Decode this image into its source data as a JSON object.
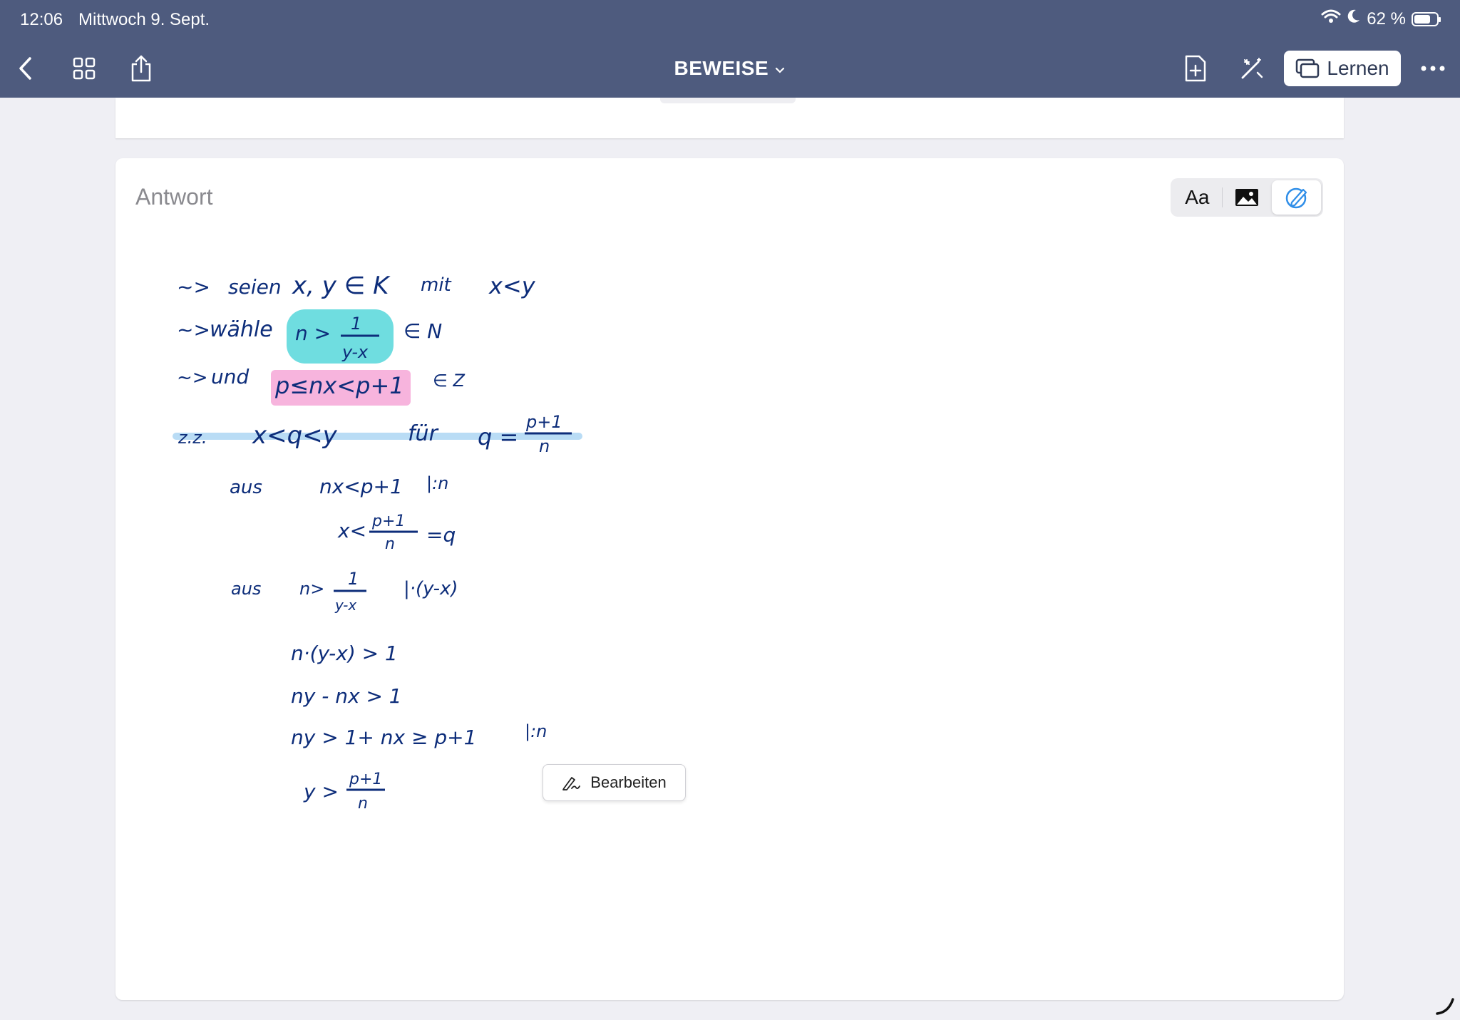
{
  "status_bar": {
    "time": "12:06",
    "date": "Mittwoch 9. Sept.",
    "battery": "62 %"
  },
  "toolbar": {
    "title": "BEWEISE",
    "lernen_label": "Lernen",
    "icons": [
      "chevron-left-icon",
      "grid-icon",
      "share-icon",
      "add-page-icon",
      "wand-icon",
      "cards-icon",
      "more-icon"
    ]
  },
  "card": {
    "label": "Antwort",
    "mode_text_label": "Aa",
    "edit_label": "Bearbeiten"
  },
  "colors": {
    "header": "#4e5b7e",
    "ink": "#0d2d7a",
    "highlight_cyan": "#6fdde0",
    "highlight_pink": "#f7b4dd",
    "highlight_blue": "#b9dcf5",
    "accent": "#2f8ee8"
  },
  "handwriting": {
    "l1_arrow": "~>",
    "l1_seien": "seien",
    "l1_vars": "x, y ∈ K",
    "l1_mit": "mit",
    "l1_cond": "x<y",
    "l2_arrow": "~>",
    "l2_waehle": "wähle",
    "l2_n": "n >",
    "l2_num": "1",
    "l2_den": "y-x",
    "l2_set": "∈ N",
    "l3_arrow": "~>",
    "l3_und": "und",
    "l3_ineq": "p≤nx<p+1",
    "l3_set": "∈ Z",
    "l4_zz": "z.z.",
    "l4_ineq": "x<q<y",
    "l4_fuer": "für",
    "l4_q": "q =",
    "l4_num": "p+1",
    "l4_den": "n",
    "l5_aus": "aus",
    "l5_ineq": "nx<p+1",
    "l5_op": "|:n",
    "l6_x": "x<",
    "l6_num": "p+1",
    "l6_den": "n",
    "l6_q": "=q",
    "l7_aus": "aus",
    "l7_n": "n>",
    "l7_num": "1",
    "l7_den": "y-x",
    "l7_op": "|·(y-x)",
    "l8": "n·(y-x) > 1",
    "l9": "ny - nx > 1",
    "l10": "ny > 1+ nx ≥ p+1",
    "l10_op": "|:n",
    "l11_y": "y >",
    "l11_num": "p+1",
    "l11_den": "n"
  }
}
